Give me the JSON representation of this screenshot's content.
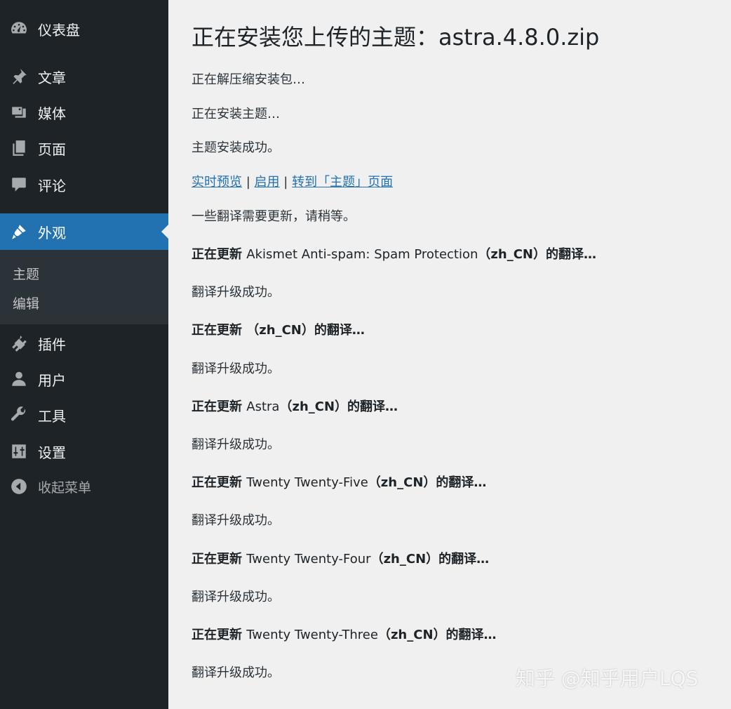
{
  "sidebar": {
    "items": [
      {
        "label": "仪表盘",
        "icon": "dashboard-icon"
      },
      {
        "label": "文章",
        "icon": "pin-icon"
      },
      {
        "label": "媒体",
        "icon": "media-icon"
      },
      {
        "label": "页面",
        "icon": "pages-icon"
      },
      {
        "label": "评论",
        "icon": "comment-icon"
      },
      {
        "label": "外观",
        "icon": "paintbrush-icon"
      },
      {
        "label": "插件",
        "icon": "plugin-icon"
      },
      {
        "label": "用户",
        "icon": "user-icon"
      },
      {
        "label": "工具",
        "icon": "wrench-icon"
      },
      {
        "label": "设置",
        "icon": "settings-icon"
      },
      {
        "label": "收起菜单",
        "icon": "collapse-icon"
      }
    ],
    "submenu": [
      {
        "label": "主题"
      },
      {
        "label": "编辑"
      }
    ],
    "active": "外观",
    "accent_color": "#2271b1"
  },
  "main": {
    "title": "正在安装您上传的主题：astra.4.8.0.zip",
    "status_lines": [
      "正在解压缩安装包…",
      "正在安装主题…",
      "主题安装成功。"
    ],
    "links": {
      "preview": "实时预览",
      "activate": "启用",
      "themes_page": "转到「主题」页面",
      "separator": "|"
    },
    "translation_notice": "一些翻译需要更新，请稍等。",
    "updates": [
      {
        "prefix": "正在更新",
        "name": "Akismet Anti-spam: Spam Protection",
        "suffix": "（zh_CN）的翻译…",
        "result": "翻译升级成功。"
      },
      {
        "prefix": "正在更新",
        "name": "",
        "suffix": "（zh_CN）的翻译…",
        "result": "翻译升级成功。"
      },
      {
        "prefix": "正在更新",
        "name": "Astra",
        "suffix": "（zh_CN）的翻译…",
        "result": "翻译升级成功。"
      },
      {
        "prefix": "正在更新",
        "name": "Twenty Twenty-Five",
        "suffix": "（zh_CN）的翻译…",
        "result": "翻译升级成功。"
      },
      {
        "prefix": "正在更新",
        "name": "Twenty Twenty-Four",
        "suffix": "（zh_CN）的翻译…",
        "result": "翻译升级成功。"
      },
      {
        "prefix": "正在更新",
        "name": "Twenty Twenty-Three",
        "suffix": "（zh_CN）的翻译…",
        "result": "翻译升级成功。"
      }
    ]
  },
  "watermark": "知乎 @知乎用户LQS"
}
